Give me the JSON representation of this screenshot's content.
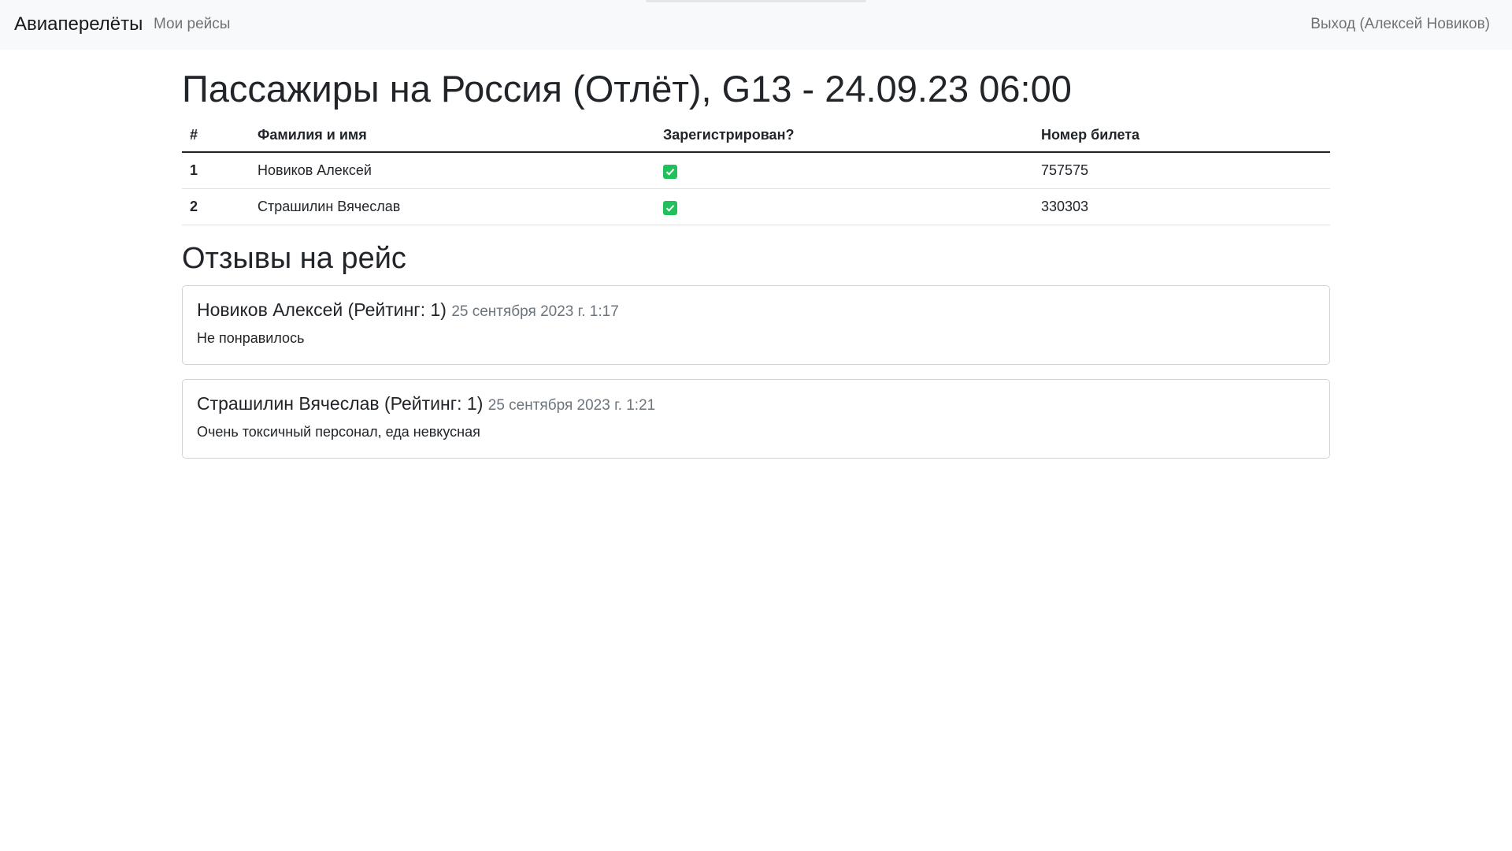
{
  "navbar": {
    "brand": "Авиаперелёты",
    "my_flights": "Мои рейсы",
    "logout": "Выход (Алексей Новиков)"
  },
  "page": {
    "title": "Пассажиры на Россия (Отлёт), G13 - 24.09.23 06:00"
  },
  "table": {
    "headers": [
      "#",
      "Фамилия и имя",
      "Зарегистрирован?",
      "Номер билета"
    ],
    "rows": [
      {
        "num": "1",
        "name": "Новиков Алексей",
        "registered": true,
        "ticket": "757575"
      },
      {
        "num": "2",
        "name": "Страшилин Вячеслав",
        "registered": true,
        "ticket": "330303"
      }
    ]
  },
  "reviews": {
    "title": "Отзывы на рейс",
    "items": [
      {
        "author": "Новиков Алексей (Рейтинг: 1)",
        "date": "25 сентября 2023 г. 1:17",
        "text": "Не понравилось"
      },
      {
        "author": "Страшилин Вячеслав (Рейтинг: 1)",
        "date": "25 сентября 2023 г. 1:21",
        "text": "Очень токсичный персонал, еда невкусная"
      }
    ]
  },
  "colors": {
    "navbar_bg": "#f8f9fa",
    "check_green": "#20c15a",
    "muted": "#6c757d"
  }
}
